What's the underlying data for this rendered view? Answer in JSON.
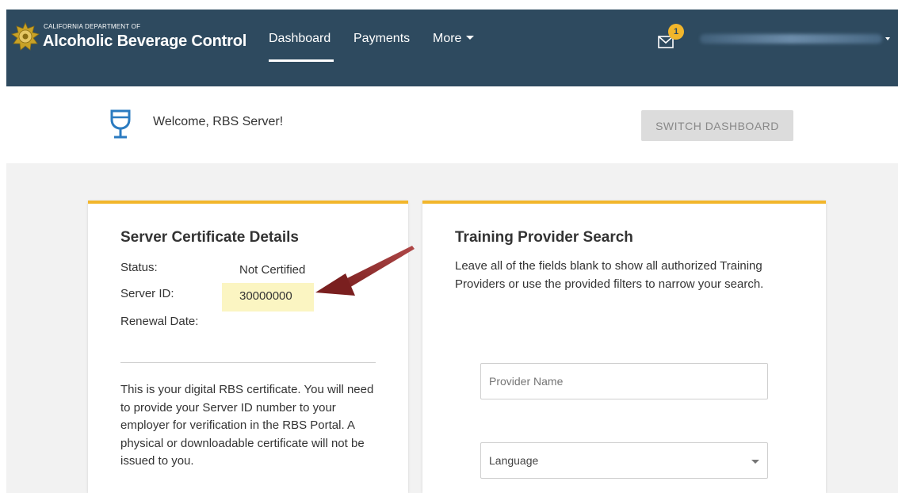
{
  "header": {
    "org_line": "CALIFORNIA DEPARTMENT OF",
    "org_name": "Alcoholic Beverage Control",
    "nav": {
      "dashboard": "Dashboard",
      "payments": "Payments",
      "more": "More"
    },
    "notification_count": "1"
  },
  "welcome": {
    "text": "Welcome, RBS Server!",
    "switch_button": "SWITCH DASHBOARD"
  },
  "certificate": {
    "title": "Server Certificate Details",
    "status_label": "Status:",
    "status_value": "Not Certified",
    "server_id_label": "Server ID:",
    "server_id_value": "30000000",
    "renewal_label": "Renewal Date:",
    "description": "This is your digital RBS certificate. You will need to provide your Server ID number to your employer for verification in the RBS Portal. A physical or downloadable certificate will not be issued to you."
  },
  "provider_search": {
    "title": "Training Provider Search",
    "description": "Leave all of the fields blank to show all authorized Training Providers or use the provided filters to narrow your search.",
    "provider_placeholder": "Provider Name",
    "language_label": "Language"
  },
  "colors": {
    "navbar": "#2e4a5f",
    "accent": "#f2b62b",
    "highlight": "#fbf5c2",
    "arrow": "#8b2a2a"
  }
}
